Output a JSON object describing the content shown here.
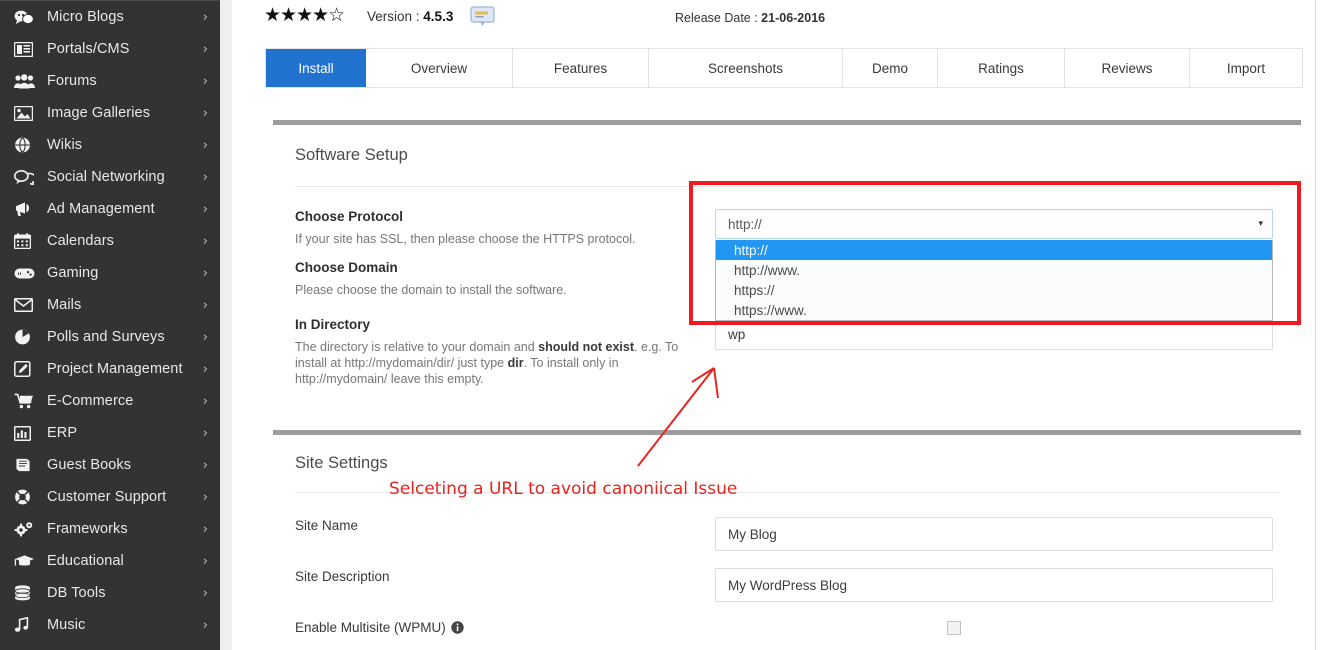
{
  "sidebar": {
    "items": [
      {
        "label": "Micro Blogs",
        "icon": "micro-blogs-icon"
      },
      {
        "label": "Portals/CMS",
        "icon": "portals-cms-icon"
      },
      {
        "label": "Forums",
        "icon": "forums-icon"
      },
      {
        "label": "Image Galleries",
        "icon": "image-galleries-icon"
      },
      {
        "label": "Wikis",
        "icon": "wikis-icon"
      },
      {
        "label": "Social Networking",
        "icon": "social-networking-icon"
      },
      {
        "label": "Ad Management",
        "icon": "ad-management-icon"
      },
      {
        "label": "Calendars",
        "icon": "calendars-icon"
      },
      {
        "label": "Gaming",
        "icon": "gaming-icon"
      },
      {
        "label": "Mails",
        "icon": "mails-icon"
      },
      {
        "label": "Polls and Surveys",
        "icon": "polls-surveys-icon"
      },
      {
        "label": "Project Management",
        "icon": "project-management-icon"
      },
      {
        "label": "E-Commerce",
        "icon": "ecommerce-icon"
      },
      {
        "label": "ERP",
        "icon": "erp-icon"
      },
      {
        "label": "Guest Books",
        "icon": "guest-books-icon"
      },
      {
        "label": "Customer Support",
        "icon": "customer-support-icon"
      },
      {
        "label": "Frameworks",
        "icon": "frameworks-icon"
      },
      {
        "label": "Educational",
        "icon": "educational-icon"
      },
      {
        "label": "DB Tools",
        "icon": "db-tools-icon"
      },
      {
        "label": "Music",
        "icon": "music-icon"
      }
    ],
    "chevron": "›"
  },
  "header": {
    "rating_stars": "★★★★",
    "rating_half_star": "☆",
    "rating_value": 4.5,
    "version_label": "Version :",
    "version_value": "4.5.3",
    "release_label": "Release Date :",
    "release_value": "21-06-2016",
    "version_icon": "changelog-icon"
  },
  "tabs": [
    {
      "label": "Install",
      "active": true
    },
    {
      "label": "Overview",
      "active": false
    },
    {
      "label": "Features",
      "active": false
    },
    {
      "label": "Screenshots",
      "active": false
    },
    {
      "label": "Demo",
      "active": false
    },
    {
      "label": "Ratings",
      "active": false
    },
    {
      "label": "Reviews",
      "active": false
    },
    {
      "label": "Import",
      "active": false
    }
  ],
  "software_setup": {
    "title": "Software Setup",
    "protocol": {
      "label": "Choose Protocol",
      "help": "If your site has SSL, then please choose the HTTPS protocol.",
      "selected": "http://",
      "caret": "▾",
      "options": [
        {
          "label": "http://",
          "selected": true
        },
        {
          "label": "http://www.",
          "selected": false
        },
        {
          "label": "https://",
          "selected": false
        },
        {
          "label": "https://www.",
          "selected": false
        }
      ]
    },
    "domain": {
      "label": "Choose Domain",
      "help": "Please choose the domain to install the software."
    },
    "directory": {
      "label": "In Directory",
      "help_pre": "The directory is relative to your domain and ",
      "help_bold1": "should not exist",
      "help_mid": ". e.g. To install at http://mydomain/dir/ just type ",
      "help_bold2": "dir",
      "help_post": ". To install only in http://mydomain/ leave this empty.",
      "value": "wp"
    }
  },
  "site_settings": {
    "title": "Site Settings",
    "site_name": {
      "label": "Site Name",
      "value": "My Blog"
    },
    "site_description": {
      "label": "Site Description",
      "value": "My WordPress Blog"
    },
    "multisite": {
      "label": "Enable Multisite (WPMU)",
      "checked": false,
      "info_icon": "info-icon"
    }
  },
  "annotation": {
    "text": "Selceting a URL to avoid canoniical Issue",
    "color": "#e8241f"
  },
  "colors": {
    "accent_blue": "#2272cf",
    "option_highlight": "#2196f3",
    "sidebar_bg": "#333333",
    "annotation_red": "#ee1c22",
    "section_bar": "#9d9d9d"
  }
}
